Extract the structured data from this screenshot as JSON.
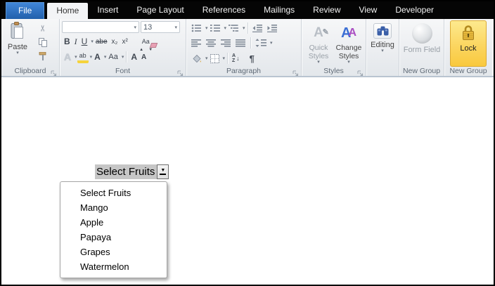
{
  "tabs": {
    "file": "File",
    "items": [
      "Home",
      "Insert",
      "Page Layout",
      "References",
      "Mailings",
      "Review",
      "View",
      "Developer"
    ],
    "active": "Home"
  },
  "ribbon": {
    "clipboard": {
      "label": "Clipboard",
      "paste": "Paste"
    },
    "font": {
      "label": "Font",
      "font_name_value": "",
      "font_size_value": "13",
      "bold": "B",
      "italic": "I",
      "underline": "U",
      "strikethrough": "abe",
      "subscript": "x₂",
      "superscript": "x²",
      "clear_formatting": "Aa",
      "text_effects": "A",
      "highlight": "ab",
      "font_color": "A",
      "change_case": "Aa",
      "grow_font": "A",
      "shrink_font": "A"
    },
    "paragraph": {
      "label": "Paragraph",
      "sort_a": "A",
      "sort_z": "Z",
      "pilcrow": "¶"
    },
    "styles": {
      "label": "Styles",
      "quick_styles": "Quick Styles",
      "change_styles": "Change Styles"
    },
    "editing": {
      "label": "Editing"
    },
    "new_group_form": {
      "label": "New Group",
      "button": "Form Field"
    },
    "new_group_lock": {
      "label": "New Group",
      "button": "Lock"
    }
  },
  "document": {
    "dropdown_field": {
      "value": "Select Fruits"
    },
    "dropdown_list": {
      "items": [
        "Select Fruits",
        "Mango",
        "Apple",
        "Papaya",
        "Grapes",
        "Watermelon"
      ]
    }
  },
  "colors": {
    "accent_blue_tab": "#2f6fc1",
    "ribbon_bg": "#eceef1",
    "lock_yellow": "#fbd45c",
    "field_shading": "#c6c6c6",
    "tabbar_black": "#050505"
  }
}
